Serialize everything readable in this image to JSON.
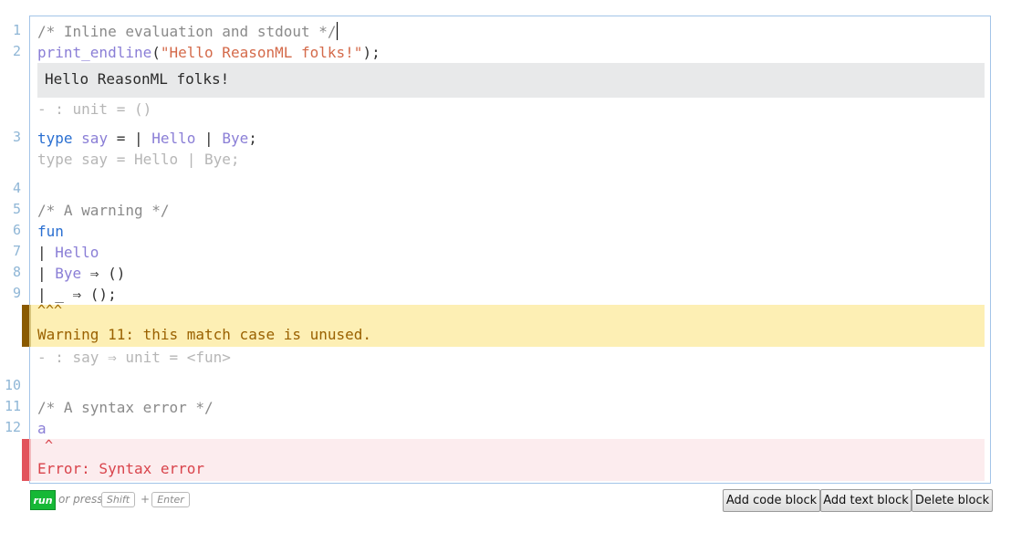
{
  "line_numbers": [
    "1",
    "2",
    "3",
    "4",
    "5",
    "6",
    "7",
    "8",
    "9",
    "10",
    "11",
    "12"
  ],
  "code": {
    "line1": "/* Inline evaluation and stdout */",
    "line2_fn": "print_endline",
    "line2_open": "(",
    "line2_str": "\"Hello ReasonML folks!\"",
    "line2_close": ");",
    "stdout": "Hello ReasonML folks!",
    "result1": "- : unit = ()",
    "line3_kw": "type",
    "line3_name": "say",
    "line3_eq": " = | ",
    "line3_hello": "Hello",
    "line3_pipe": " | ",
    "line3_bye": "Bye",
    "line3_semi": ";",
    "result2": "type say = Hello | Bye;",
    "line5": "/* A warning */",
    "line6": "fun",
    "line7_pipe": "| ",
    "line7_hello": "Hello",
    "line8_pipe": "| ",
    "line8_bye": "Bye",
    "line8_arrow": " ⇒ ()",
    "line9": "| _ ⇒ ();",
    "warn_caret": "^^^",
    "warn_msg": "Warning 11: this match case is unused.",
    "result3": "- : say ⇒ unit = <fun>",
    "line11": "/* A syntax error */",
    "line12": "a",
    "err_caret": "^",
    "err_msg": "Error: Syntax error"
  },
  "footer": {
    "run_label": "run",
    "or_press": "or press",
    "key_shift": "Shift",
    "plus": "+",
    "key_enter": "Enter"
  },
  "buttons": {
    "add_code": "Add code block",
    "add_text": "Add text block",
    "delete": "Delete block"
  },
  "colors": {
    "run_green": "#16b836",
    "warning_bg": "#fdefb4",
    "error_bg": "#fcecee",
    "error_text": "#d9434b",
    "keyword": "#2a6fd1",
    "constructor": "#8a7ed6"
  }
}
